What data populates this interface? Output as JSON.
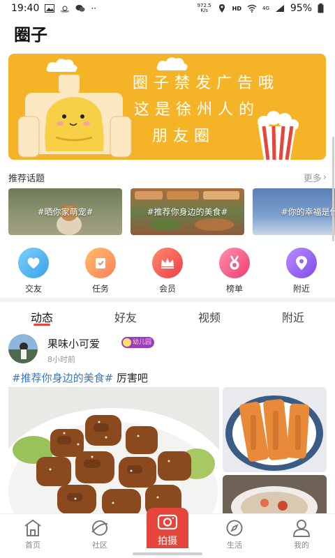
{
  "status_bar": {
    "time": "19:40",
    "speed_value": "972.5",
    "speed_unit": "K/s",
    "network_type": "HD",
    "signal_label": "4G",
    "battery": "95%",
    "icons": [
      "image-icon",
      "weather-icon",
      "wechat-icon",
      "more-dots-icon",
      "location-icon",
      "wifi-icon",
      "signal-icon",
      "battery-icon"
    ]
  },
  "header": {
    "title": "圈子"
  },
  "banner": {
    "lines": [
      "圈子禁发广告哦",
      "这是徐州人的",
      "朋友圈"
    ],
    "background": "#f5b427"
  },
  "topics_section": {
    "title": "推荐话题",
    "more": "更多",
    "items": [
      {
        "label": "#晒你家萌宠#"
      },
      {
        "label": "#推荐你身边的美食#"
      },
      {
        "label": "#你的幸福是什"
      }
    ]
  },
  "quick_links": [
    {
      "label": "交友",
      "icon": "heart-chat-icon",
      "color": "#4fb6f0"
    },
    {
      "label": "任务",
      "icon": "task-icon",
      "color": "#ff9a3c"
    },
    {
      "label": "会员",
      "icon": "crown-icon",
      "color": "#f0584e"
    },
    {
      "label": "榜单",
      "icon": "medal-icon",
      "color": "#f35a86"
    },
    {
      "label": "附近",
      "icon": "location-pin-icon",
      "color": "#9a62f2"
    }
  ],
  "feed_tabs": [
    {
      "label": "动态",
      "active": true
    },
    {
      "label": "好友",
      "active": false
    },
    {
      "label": "视频",
      "active": false
    },
    {
      "label": "附近",
      "active": false
    }
  ],
  "post": {
    "author": "果味小可爱",
    "badge": "幼儿园",
    "time": "8小时前",
    "hashtag": "#推荐你身边的美食#",
    "text": " 厉害吧"
  },
  "bottom_nav": [
    {
      "label": "首页",
      "icon": "home-icon"
    },
    {
      "label": "社区",
      "icon": "planet-icon"
    },
    {
      "label": "拍摄",
      "icon": "camera-icon"
    },
    {
      "label": "生活",
      "icon": "compass-icon"
    },
    {
      "label": "我的",
      "icon": "user-icon"
    }
  ],
  "colors": {
    "accent": "#e6453b",
    "hashtag": "#3a78c9"
  }
}
